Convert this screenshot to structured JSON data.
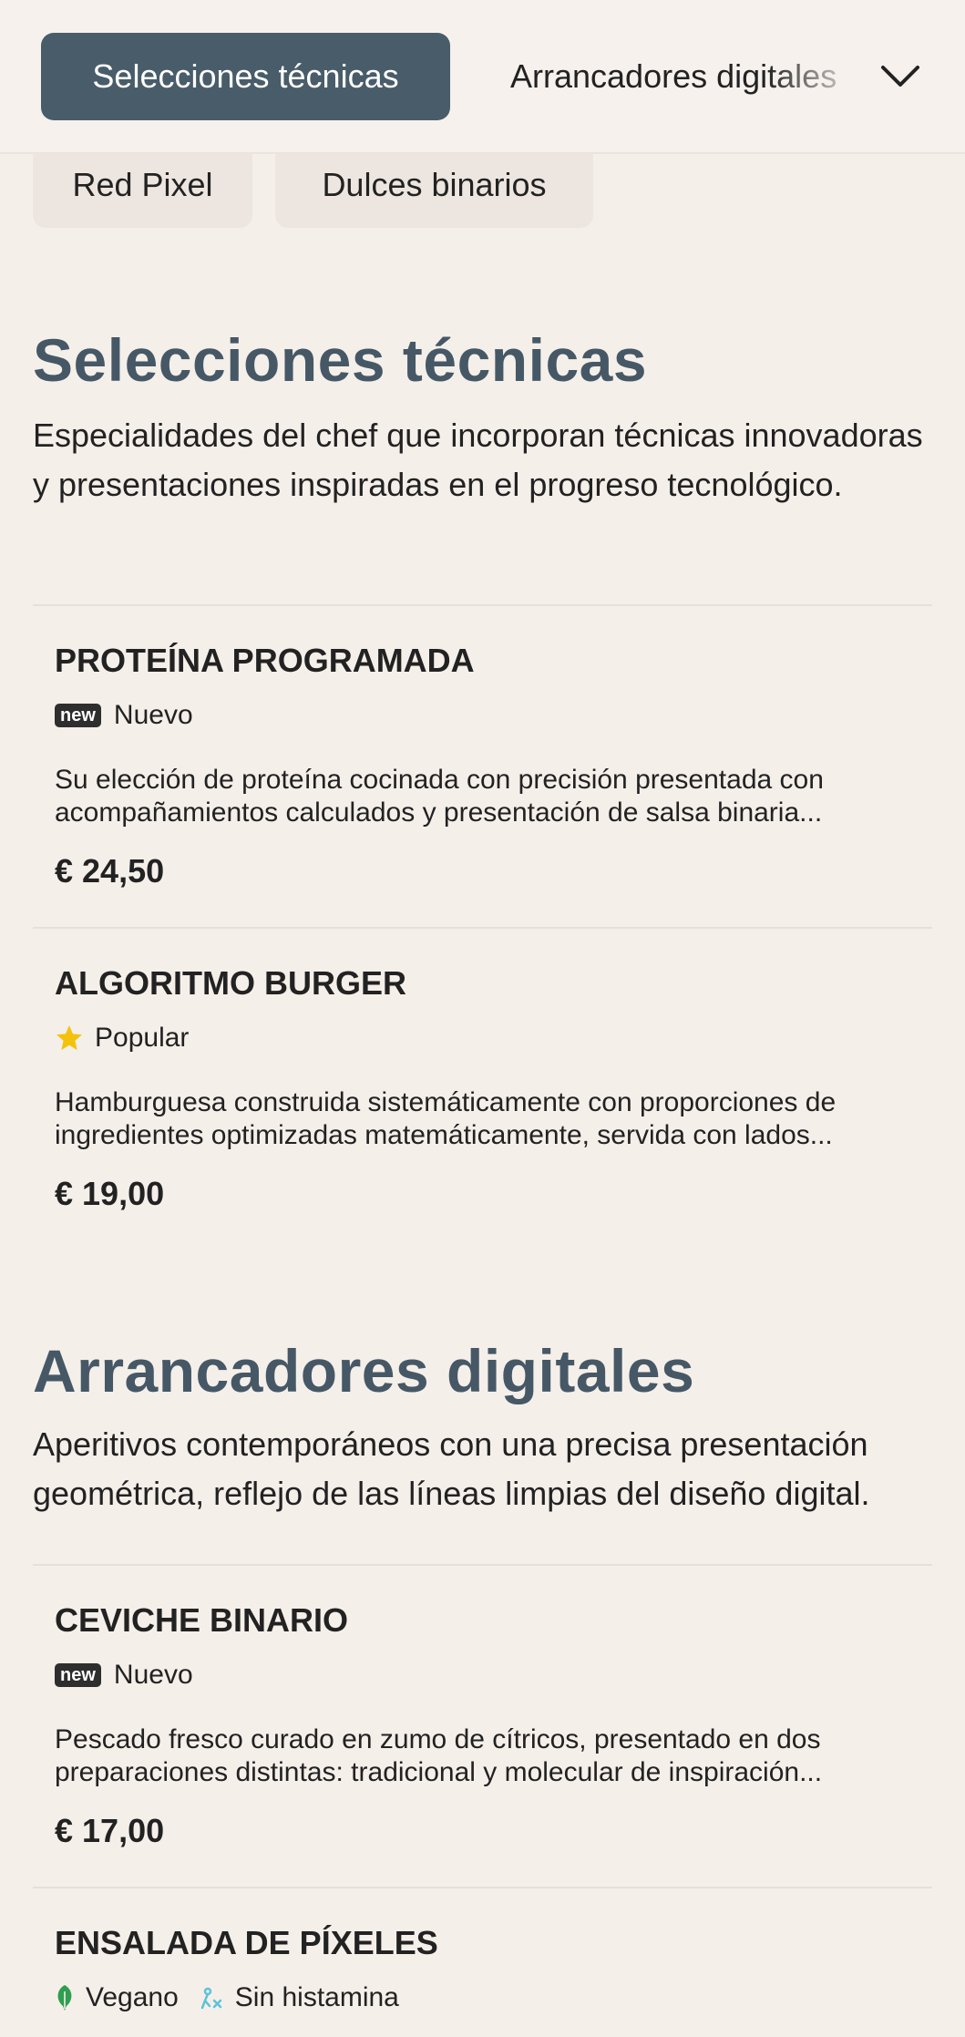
{
  "nav": {
    "active_tab": "Selecciones técnicas",
    "next_tab": "Arrancadores digitales",
    "chips": [
      "Red Pixel",
      "Dulces binarios"
    ]
  },
  "sections": [
    {
      "title": "Selecciones técnicas",
      "description": "Especialidades del chef que incorporan técnicas innovadoras y presentaciones inspiradas en el progreso tecnológico.",
      "items": [
        {
          "name": "PROTEÍNA PROGRAMADA",
          "badge_icon": "new",
          "badge_label": "Nuevo",
          "description": "Su elección de proteína cocinada con precisión presentada con acompañamientos calculados y presentación de salsa binaria...",
          "price": "€ 24,50"
        },
        {
          "name": "ALGORITMO BURGER",
          "badge_icon": "star-icon",
          "badge_label": "Popular",
          "description": "Hamburguesa construida sistemáticamente con proporciones de ingredientes optimizadas matemáticamente, servida con lados...",
          "price": "€ 19,00"
        }
      ]
    },
    {
      "title": "Arrancadores digitales",
      "description": "Aperitivos contemporáneos con una precisa presentación geométrica, reflejo de las líneas limpias del diseño digital.",
      "items": [
        {
          "name": "CEVICHE BINARIO",
          "badge_icon": "new",
          "badge_label": "Nuevo",
          "description": "Pescado fresco curado en zumo de cítricos, presentado en dos preparaciones distintas: tradicional y molecular de inspiración...",
          "price": "€ 17,00"
        },
        {
          "name": "ENSALADA DE PÍXELES",
          "tags": [
            {
              "icon": "leaf-icon",
              "label": "Vegano",
              "color": "#2e9e4f"
            },
            {
              "icon": "histamine-free-icon",
              "label": "Sin histamina",
              "color": "#5cc3d8"
            }
          ]
        }
      ]
    }
  ],
  "colors": {
    "background": "#f5efea",
    "accent": "#495c69",
    "title": "#465866",
    "star": "#f4c20d"
  }
}
